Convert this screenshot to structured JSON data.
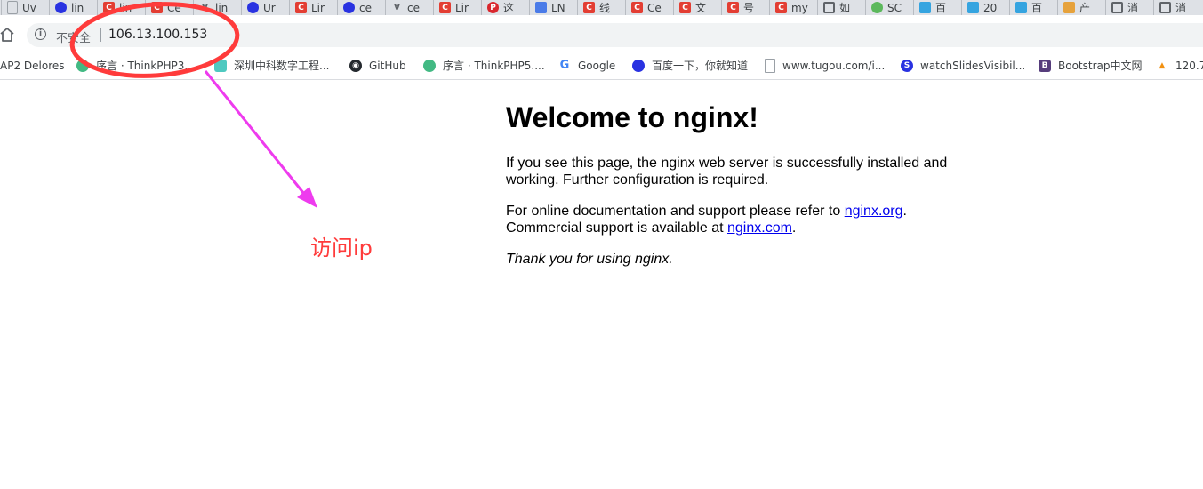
{
  "tabs": [
    {
      "label": "Uv",
      "icon": "document-icon",
      "color": "#9aa0a6"
    },
    {
      "label": "lin",
      "icon": "paw-icon",
      "color": "#2932e1"
    },
    {
      "label": "lin",
      "icon": "csdn-icon",
      "color": "#e33e33"
    },
    {
      "label": "Ce",
      "icon": "csdn-icon",
      "color": "#e33e33"
    },
    {
      "label": "lin",
      "icon": "angle-icon",
      "color": "#5f6368"
    },
    {
      "label": "Ur",
      "icon": "paw-icon",
      "color": "#2932e1"
    },
    {
      "label": "Lir",
      "icon": "csdn-icon",
      "color": "#e33e33"
    },
    {
      "label": "ce",
      "icon": "paw-icon",
      "color": "#2932e1"
    },
    {
      "label": "ce",
      "icon": "angle-icon",
      "color": "#5f6368"
    },
    {
      "label": "Lir",
      "icon": "csdn-icon",
      "color": "#e33e33"
    },
    {
      "label": "这",
      "icon": "php-icon",
      "color": "#d9272e"
    },
    {
      "label": "LN",
      "icon": "pen-icon",
      "color": "#4a7be8"
    },
    {
      "label": "线",
      "icon": "csdn-icon",
      "color": "#e33e33"
    },
    {
      "label": "Ce",
      "icon": "csdn-icon",
      "color": "#e33e33"
    },
    {
      "label": "文",
      "icon": "csdn-icon",
      "color": "#e33e33"
    },
    {
      "label": "号",
      "icon": "csdn-icon",
      "color": "#e33e33"
    },
    {
      "label": "my",
      "icon": "csdn-icon",
      "color": "#e33e33"
    },
    {
      "label": "如",
      "icon": "bracket-icon",
      "color": "#5f6368"
    },
    {
      "label": "SC",
      "icon": "circle-icon",
      "color": "#5cb85c"
    },
    {
      "label": "百",
      "icon": "hexagon-icon",
      "color": "#35a4e0"
    },
    {
      "label": "20",
      "icon": "hexagon-icon",
      "color": "#35a4e0"
    },
    {
      "label": "百",
      "icon": "hexagon-icon",
      "color": "#35a4e0"
    },
    {
      "label": "产",
      "icon": "hexagon-icon",
      "color": "#e6a23c"
    },
    {
      "label": "消",
      "icon": "bracket-icon",
      "color": "#5f6368"
    },
    {
      "label": "消",
      "icon": "bracket-icon",
      "color": "#5f6368"
    }
  ],
  "address": {
    "security_label": "不安全",
    "url": "106.13.100.153"
  },
  "bookmarks": [
    {
      "label": "AP2 Delores",
      "icon": "",
      "color": "#ffffff"
    },
    {
      "label": "序言 · ThinkPHP3....",
      "icon": "leaf-icon",
      "color": "#42b983"
    },
    {
      "label": "深圳中科数字工程...",
      "icon": "bookmark-app-icon",
      "color": "#4ec9c0"
    },
    {
      "label": "GitHub",
      "icon": "github-icon",
      "color": "#24292e"
    },
    {
      "label": "序言 · ThinkPHP5....",
      "icon": "leaf-icon",
      "color": "#42b983"
    },
    {
      "label": "Google",
      "icon": "google-icon",
      "color": "#4285f4"
    },
    {
      "label": "百度一下，你就知道",
      "icon": "paw-icon",
      "color": "#2932e1"
    },
    {
      "label": "www.tugou.com/i...",
      "icon": "document-icon",
      "color": "#9aa0a6"
    },
    {
      "label": "watchSlidesVisibil...",
      "icon": "s-icon",
      "color": "#2932e1"
    },
    {
      "label": "Bootstrap中文网",
      "icon": "bootstrap-icon",
      "color": "#563d7c"
    },
    {
      "label": "120.7",
      "icon": "phpmyadmin-icon",
      "color": "#f29111"
    }
  ],
  "page": {
    "heading": "Welcome to nginx!",
    "para1": "If you see this page, the nginx web server is successfully installed and working. Further configuration is required.",
    "para2_prefix": "For online documentation and support please refer to ",
    "link_org": "nginx.org",
    "para2_mid": ".",
    "para2_line2_prefix": "Commercial support is available at ",
    "link_com": "nginx.com",
    "para2_suffix": ".",
    "para3": "Thank you for using nginx."
  },
  "annotation": {
    "text": "访问ip",
    "circle_color": "#ff3b3b",
    "arrow_color": "#ee3bee"
  }
}
